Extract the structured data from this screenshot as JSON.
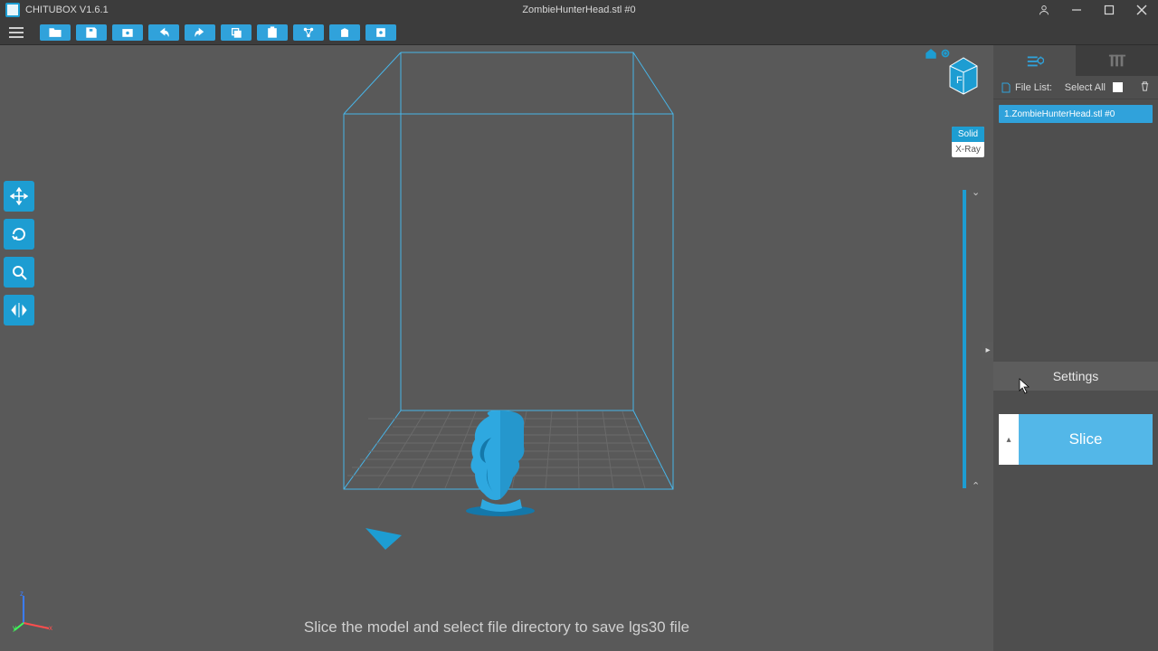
{
  "app": {
    "name": "CHITUBOX V1.6.1",
    "document": "ZombieHunterHead.stl #0"
  },
  "toolbar": {
    "buttons": [
      "open",
      "save",
      "screenshot",
      "undo",
      "redo",
      "copy",
      "paste",
      "support",
      "hollow",
      "dig"
    ]
  },
  "left_tools": [
    "move",
    "rotate",
    "scale",
    "mirror"
  ],
  "render_mode": {
    "solid": "Solid",
    "xray": "X-Ray",
    "active": "solid"
  },
  "right_panel": {
    "tab_active": "settings",
    "file_list_label": "File List:",
    "select_all_label": "Select All",
    "files": [
      "1.ZombieHunterHead.stl #0"
    ],
    "settings_label": "Settings",
    "slice_label": "Slice"
  },
  "hint": "Slice the model and select file directory to save lgs30 file",
  "axis": {
    "x": "x",
    "y": "y",
    "z": "z"
  },
  "viewcube": {
    "face": "F"
  }
}
